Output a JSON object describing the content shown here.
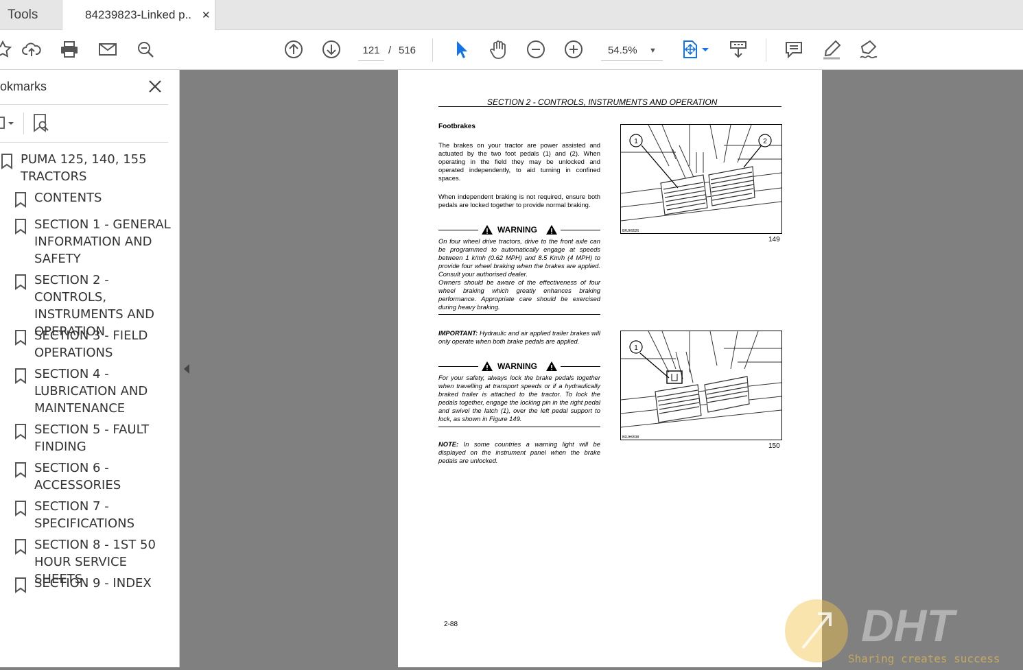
{
  "tabs": {
    "tools": "Tools",
    "document": "84239823-Linked p..."
  },
  "toolbar": {
    "page_current": "121",
    "page_separator": "/",
    "page_total": "516",
    "zoom": "54.5%"
  },
  "sidebar": {
    "title": "okmarks",
    "items": [
      {
        "label": "PUMA 125, 140, 155 TRACTORS",
        "level": 0
      },
      {
        "label": "CONTENTS",
        "level": 1
      },
      {
        "label": "SECTION 1 - GENERAL INFORMATION AND SAFETY",
        "level": 1
      },
      {
        "label": "SECTION 2 - CONTROLS, INSTRUMENTS AND OPERATION",
        "level": 1
      },
      {
        "label": "SECTION 3 - FIELD OPERATIONS",
        "level": 1
      },
      {
        "label": "SECTION 4 - LUBRICATION AND MAINTENANCE",
        "level": 1
      },
      {
        "label": "SECTION 5 - FAULT FINDING",
        "level": 1
      },
      {
        "label": "SECTION 6 - ACCESSORIES",
        "level": 1
      },
      {
        "label": "SECTION 7 - SPECIFICATIONS",
        "level": 1
      },
      {
        "label": "SECTION 8 - 1ST 50 HOUR SERVICE SHEETS",
        "level": 1
      },
      {
        "label": "SECTION 9 - INDEX",
        "level": 1
      }
    ]
  },
  "document": {
    "header": "SECTION 2  - CONTROLS, INSTRUMENTS AND OPERATION",
    "heading": "Footbrakes",
    "para1": "The brakes on your tractor are power assisted and actuated by the two foot pedals (1) and (2). When operating in the field they may be unlocked and operated independently, to aid turning in confined spaces.",
    "para2": "When independent braking is not required, ensure both pedals are locked together to provide normal braking.",
    "warning_label": "WARNING",
    "warning1a": "On four wheel drive tractors, drive to the front axle can be programmed to automatically engage at speeds between 1 k/mh (0.62 MPH) and 8.5 Km/h (4 MPH) to provide four wheel braking when the brakes are applied. Consult your authorised dealer.",
    "warning1b": "Owners should be aware of the effectiveness of four wheel braking which greatly enhances braking performance. Appropriate care should be exercised during heavy braking.",
    "important_label": "IMPORTANT:",
    "important_text": "Hydraulic and air applied trailer brakes will only operate when both brake pedals are applied.",
    "warning2": "For your safety, always lock the brake pedals together when travelling at transport speeds or if a hydraulically braked trailer is attached to the tractor. To lock the pedals together, engage the locking pin in the right pedal and swivel the latch (1), over the left pedal support to lock, as shown in Figure 149.",
    "note_label": "NOTE:",
    "note_text": "In some countries a warning light will be displayed on the instrument panel when the brake pedals are unlocked.",
    "fig1_number": "149",
    "fig1_code": "BRJH9526",
    "fig1_callouts": [
      "1",
      "2"
    ],
    "fig2_number": "150",
    "fig2_code": "BRJH9538",
    "fig2_callouts": [
      "1"
    ],
    "page_number": "2-88"
  },
  "watermark": {
    "brand": "DHT",
    "slogan": "Sharing creates success"
  },
  "colors": {
    "accent": "#1473e6",
    "canvas": "#808080"
  }
}
